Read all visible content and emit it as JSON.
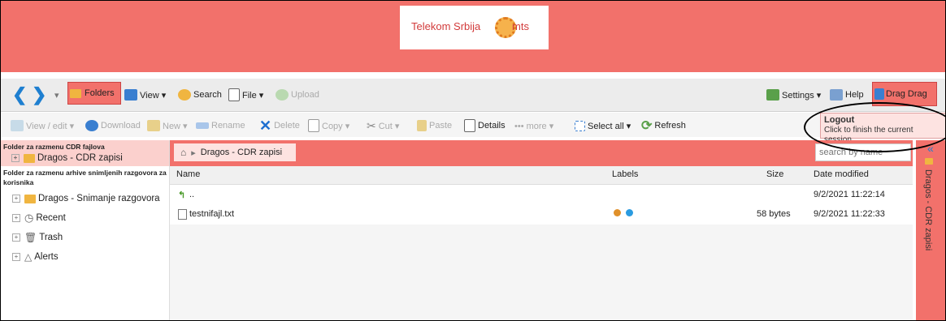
{
  "banner": {
    "brand_text": "Telekom Srbija",
    "mts_text": "mts"
  },
  "toolbar1": {
    "folders": "Folders",
    "view": "View ▾",
    "search": "Search",
    "file": "File ▾",
    "upload": "Upload",
    "settings": "Settings ▾",
    "help": "Help",
    "dragdrop": "Drag Drag"
  },
  "toolbar2": {
    "view_edit": "View / edit ▾",
    "download": "Download",
    "new": "New ▾",
    "rename": "Rename",
    "delete": "Delete",
    "copy": "Copy ▾",
    "cut": "Cut ▾",
    "paste": "Paste",
    "details": "Details",
    "more": "••• more ▾",
    "select_all": "Select all ▾",
    "refresh": "Refresh"
  },
  "logout": {
    "title": "Logout",
    "desc": "Click to finish the current session"
  },
  "sidebar": {
    "section1": "Folder za razmenu CDR fajlova",
    "item1": "Dragos - CDR zapisi",
    "section2": "Folder za razmenu arhive snimljenih razgovora za korisnika",
    "item2": "Dragos - Snimanje razgovora",
    "recent": "Recent",
    "trash": "Trash",
    "alerts": "Alerts"
  },
  "breadcrumb": {
    "current": "Dragos - CDR zapisi"
  },
  "search": {
    "placeholder": "search by name"
  },
  "columns": {
    "name": "Name",
    "labels": "Labels",
    "size": "Size",
    "date": "Date modified"
  },
  "rows": [
    {
      "name": "..",
      "size": "",
      "date": "9/2/2021 11:22:14"
    },
    {
      "name": "testnifajl.txt",
      "size": "58 bytes",
      "date": "9/2/2021 11:22:33"
    }
  ],
  "label_colors": [
    "#e0902a",
    "#2a9be0"
  ],
  "right_rail": {
    "label": "Dragos - CDR zapisi"
  },
  "colors": {
    "accent": "#f2716b",
    "highlight": "#fde3e1"
  }
}
